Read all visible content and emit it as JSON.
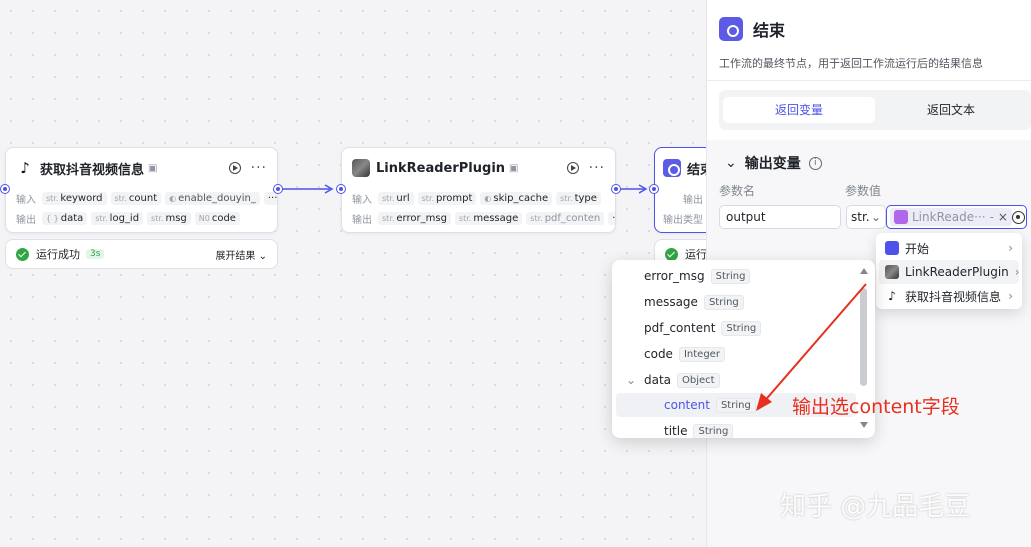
{
  "colors": {
    "accent": "#4d53e8",
    "success": "#32a645",
    "annotation": "#e6301f"
  },
  "node1": {
    "title": "获取抖音视频信息",
    "input_label": "输入",
    "inputs": [
      {
        "type": "str.",
        "name": "keyword"
      },
      {
        "type": "str.",
        "name": "count"
      },
      {
        "type": "toggle",
        "name": "enable_douyin_"
      }
    ],
    "output_label": "输出",
    "outputs": [
      {
        "type": "{ }",
        "name": "data"
      },
      {
        "type": "str.",
        "name": "log_id"
      },
      {
        "type": "str.",
        "name": "msg"
      },
      {
        "type": "N0",
        "name": "code"
      }
    ],
    "status": {
      "text": "运行成功",
      "time": "3s",
      "expand": "展开结果"
    }
  },
  "node2": {
    "title": "LinkReaderPlugin",
    "input_label": "输入",
    "inputs": [
      {
        "type": "str.",
        "name": "url"
      },
      {
        "type": "str.",
        "name": "prompt"
      },
      {
        "type": "toggle",
        "name": "skip_cache"
      },
      {
        "type": "str.",
        "name": "type"
      }
    ],
    "output_label": "输出",
    "outputs": [
      {
        "type": "str.",
        "name": "error_msg"
      },
      {
        "type": "str.",
        "name": "message"
      },
      {
        "type": "str.",
        "name": "pdf_conten"
      }
    ]
  },
  "node3": {
    "title": "结束",
    "input_label": "输出",
    "output_label": "输出类型",
    "status_text": "运行"
  },
  "panel": {
    "title": "结束",
    "description": "工作流的最终节点，用于返回工作流运行后的结果信息",
    "tabs": [
      "返回变量",
      "返回文本"
    ],
    "section_title": "输出变量",
    "col_name": "参数名",
    "col_value": "参数值",
    "param_name": "output",
    "type_select": "str.",
    "ref_value": "LinkReade···",
    "ref_sep": "-"
  },
  "source_menu": {
    "items": [
      "开始",
      "LinkReaderPlugin",
      "获取抖音视频信息"
    ]
  },
  "field_dropdown": {
    "items": [
      {
        "name": "error_msg",
        "type": "String"
      },
      {
        "name": "message",
        "type": "String"
      },
      {
        "name": "pdf_content",
        "type": "String"
      },
      {
        "name": "code",
        "type": "Integer"
      },
      {
        "name": "data",
        "type": "Object"
      },
      {
        "name": "content",
        "type": "String"
      },
      {
        "name": "title",
        "type": "String"
      }
    ]
  },
  "annotation": "输出选content字段",
  "watermark": "知乎 @九品毛豆"
}
